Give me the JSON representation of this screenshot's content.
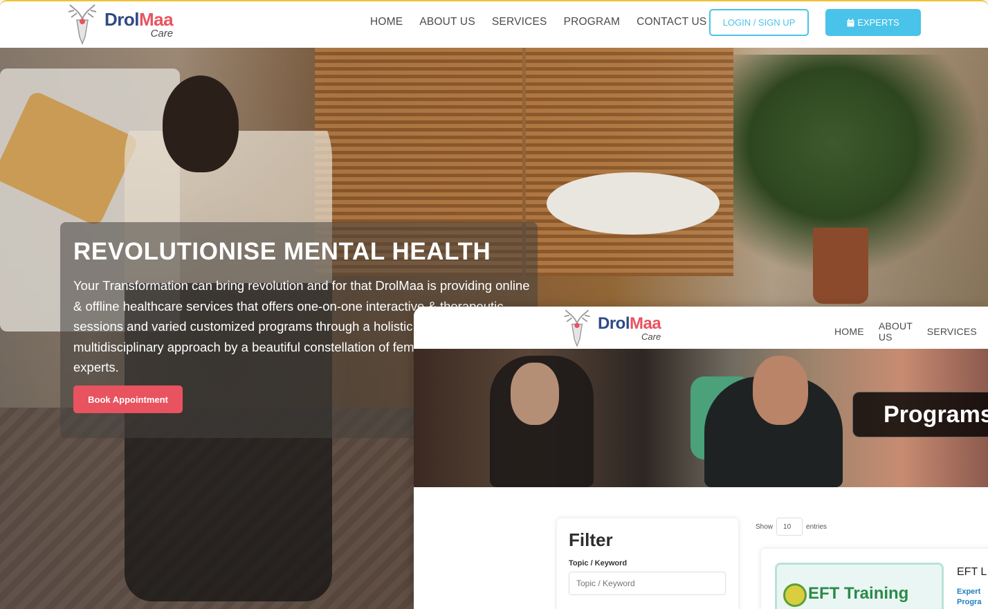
{
  "main_site": {
    "brand": {
      "name_part1": "Drol",
      "name_part2": "Maa",
      "subtitle": "Care"
    },
    "nav": {
      "items": [
        "HOME",
        "ABOUT US",
        "SERVICES",
        "PROGRAM",
        "CONTACT US"
      ]
    },
    "login_label": "LOGIN / SIGN UP",
    "experts_label": "EXPERTS",
    "hero": {
      "title": "REVOLUTIONISE MENTAL HEALTH",
      "text": "Your Transformation can bring revolution and for that DrolMaa is providing online & offline healthcare services that offers one-on-one interactive & therapeutic sessions and varied customized programs through a holistic and multidisciplinary approach by a beautiful constellation of female mental health experts.",
      "cta": "Book Appointment"
    }
  },
  "programs_site": {
    "brand": {
      "name_part1": "Drol",
      "name_part2": "Maa",
      "subtitle": "Care"
    },
    "nav": {
      "items": [
        "HOME",
        "ABOUT US",
        "SERVICES"
      ]
    },
    "banner_title": "Programs",
    "filter": {
      "title": "Filter",
      "topic_label": "Topic / Keyword",
      "topic_placeholder": "Topic / Keyword"
    },
    "entries": {
      "show": "Show",
      "value": "10",
      "suffix": "entries"
    },
    "program_card": {
      "thumb_title": "EFT Training",
      "name": "EFT L",
      "meta1": "Expert",
      "meta2": "Progra"
    }
  },
  "colors": {
    "accent_blue": "#49c3e9",
    "accent_pink": "#e8535f",
    "brand_navy": "#2f4a86"
  }
}
